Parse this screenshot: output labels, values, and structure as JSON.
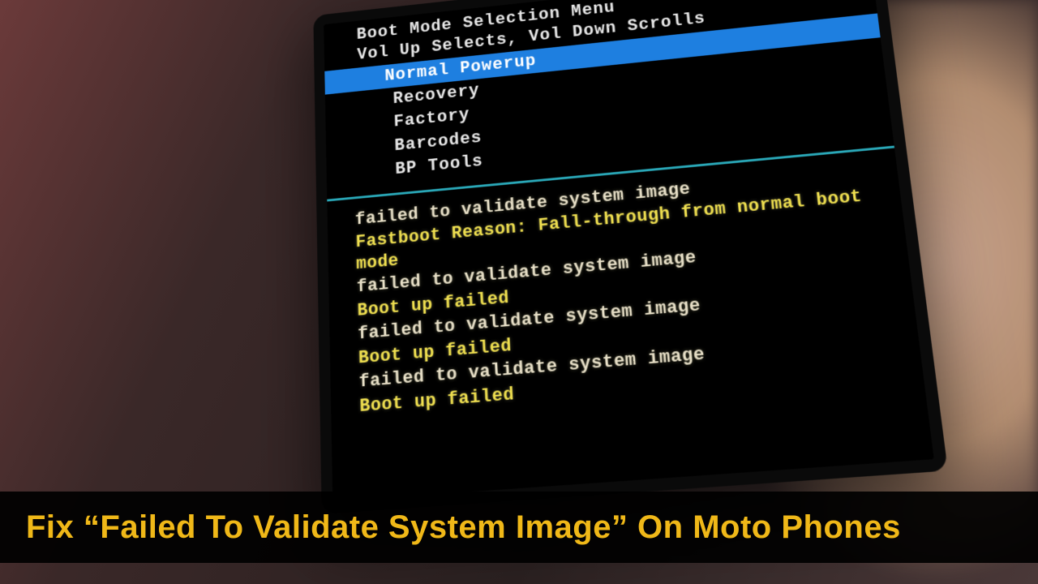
{
  "header": {
    "line1": "Boot Mode Selection Menu",
    "line2": "Vol Up Selects, Vol Down Scrolls"
  },
  "menu": {
    "items": [
      {
        "label": "Normal Powerup",
        "selected": true
      },
      {
        "label": "Recovery",
        "selected": false
      },
      {
        "label": "Factory",
        "selected": false
      },
      {
        "label": "Barcodes",
        "selected": false
      },
      {
        "label": "BP Tools",
        "selected": false
      }
    ]
  },
  "log": {
    "lines": [
      {
        "text": "failed to validate system image",
        "kind": "err"
      },
      {
        "text": "Fastboot Reason: Fall-through from normal boot mode",
        "kind": "reason"
      },
      {
        "text": "failed to validate system image",
        "kind": "err"
      },
      {
        "text": "Boot up failed",
        "kind": "bootfail"
      },
      {
        "text": "failed to validate system image",
        "kind": "err"
      },
      {
        "text": "Boot up failed",
        "kind": "bootfail"
      },
      {
        "text": "failed to validate system image",
        "kind": "err"
      },
      {
        "text": "Boot up failed",
        "kind": "bootfail"
      }
    ]
  },
  "caption": "Fix “Failed To Validate System Image” On Moto Phones"
}
